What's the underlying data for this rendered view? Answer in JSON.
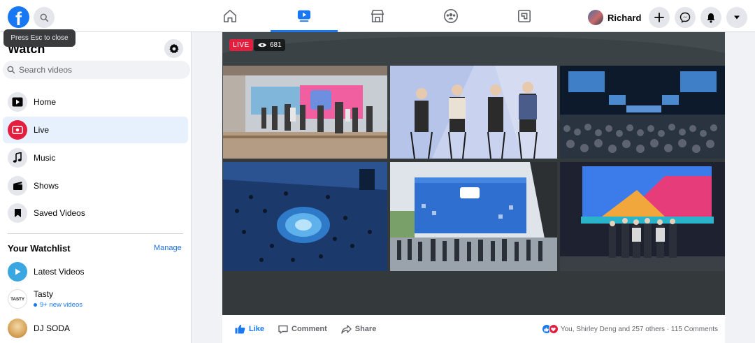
{
  "header": {
    "logo_letter": "f",
    "tooltip": "Press Esc to close",
    "profile_name": "Richard",
    "nav_tabs": [
      "home",
      "watch",
      "marketplace",
      "groups",
      "gaming"
    ]
  },
  "sidebar": {
    "title": "Watch",
    "search_placeholder": "Search videos",
    "items": [
      {
        "label": "Home",
        "icon": "play-icon"
      },
      {
        "label": "Live",
        "icon": "live-icon"
      },
      {
        "label": "Music",
        "icon": "music-note-icon"
      },
      {
        "label": "Shows",
        "icon": "clapperboard-icon"
      },
      {
        "label": "Saved Videos",
        "icon": "bookmark-icon"
      }
    ],
    "active_item": "Live",
    "watchlist": {
      "title": "Your Watchlist",
      "manage_label": "Manage",
      "items": [
        {
          "name": "Latest Videos",
          "sub": ""
        },
        {
          "name": "Tasty",
          "sub": "9+ new videos",
          "avatar_text": "TASTY"
        },
        {
          "name": "DJ SODA",
          "sub": ""
        }
      ]
    }
  },
  "video": {
    "live_label": "LIVE",
    "viewer_count": "681"
  },
  "actions": {
    "like_label": "Like",
    "comment_label": "Comment",
    "share_label": "Share",
    "reactions_text": "You, Shirley Deng and 257 others · 115 Comments"
  },
  "colors": {
    "brand": "#1877f2",
    "live": "#e41e3f",
    "active_bg": "#e7f0fd"
  }
}
